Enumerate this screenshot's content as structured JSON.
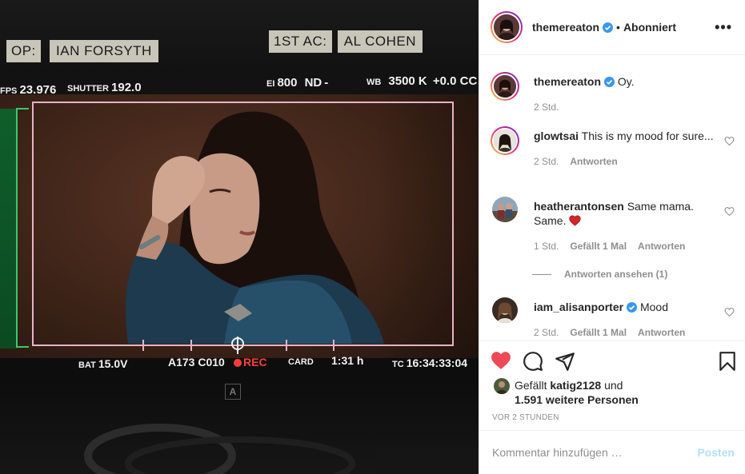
{
  "photo": {
    "tape_left": {
      "prefix": "OP:",
      "name": "IAN FORSYTH"
    },
    "tape_right": {
      "prefix": "1ST AC:",
      "name": "AL COHEN"
    },
    "osd_top": {
      "fps_label": "FPS",
      "fps_value": "23.976",
      "shutter_label": "SHUTTER",
      "shutter_value": "192.0",
      "ei_label": "EI",
      "ei_value": "800",
      "nd_label": "ND",
      "nd_value": "-",
      "wb_label": "WB",
      "wb_value": "3500 K",
      "cc_value": "+0.0 CC"
    },
    "osd_bottom": {
      "bat_label": "BAT",
      "bat_value": "15.0V",
      "clip": "A173 C010",
      "rec": "REC",
      "card_label": "CARD",
      "card_value": "1:31 h",
      "tc_label": "TC",
      "tc_value": "16:34:33:04"
    },
    "camera_letter": "A"
  },
  "post": {
    "author": "themereaton",
    "follow_state": "Abonniert",
    "separator": "•",
    "more_icon": "more-horizontal-icon"
  },
  "comments": [
    {
      "user": "themereaton",
      "verified": true,
      "text": "Oy.",
      "time": "2 Std.",
      "likes": "",
      "reply": ""
    },
    {
      "user": "glowtsai",
      "verified": false,
      "text": "This is my mood for sure...",
      "time": "2 Std.",
      "likes": "",
      "reply": "Antworten"
    },
    {
      "user": "heatherantonsen",
      "verified": false,
      "text": "Same mama. Same.",
      "time": "1 Std.",
      "likes": "Gefällt 1 Mal",
      "reply": "Antworten"
    },
    {
      "user": "iam_alisanporter",
      "verified": true,
      "text": "Mood",
      "time": "2 Std.",
      "likes": "Gefällt 1 Mal",
      "reply": "Antworten"
    }
  ],
  "view_replies": "Antworten ansehen (1)",
  "likes": {
    "prefix": "Gefällt",
    "user": "katig2128",
    "middle": "und",
    "others": "1.591 weitere Personen"
  },
  "timestamp": "VOR 2 STUNDEN",
  "add_comment": {
    "placeholder": "Kommentar hinzufügen …",
    "post_label": "Posten"
  },
  "colors": {
    "heart_liked": "#ed4956",
    "verified": "#3897f0",
    "post_button": "#b2dffc",
    "muted": "#8e8e8e"
  }
}
